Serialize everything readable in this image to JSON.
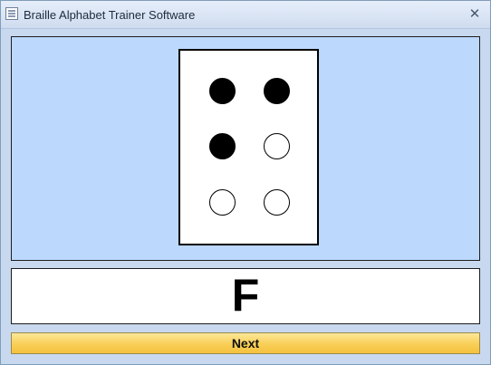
{
  "window": {
    "title": "Braille Alphabet Trainer Software",
    "close_glyph": "✕"
  },
  "braille": {
    "dots": [
      {
        "index": 1,
        "filled": true
      },
      {
        "index": 4,
        "filled": true
      },
      {
        "index": 2,
        "filled": true
      },
      {
        "index": 5,
        "filled": false
      },
      {
        "index": 3,
        "filled": false
      },
      {
        "index": 6,
        "filled": false
      }
    ]
  },
  "letter_display": {
    "letter": "F"
  },
  "next_button": {
    "label": "Next"
  },
  "colors": {
    "window_background": "#c7d8ef",
    "braille_panel": "#bcd8fd",
    "button_gold": "#f8cf57"
  }
}
